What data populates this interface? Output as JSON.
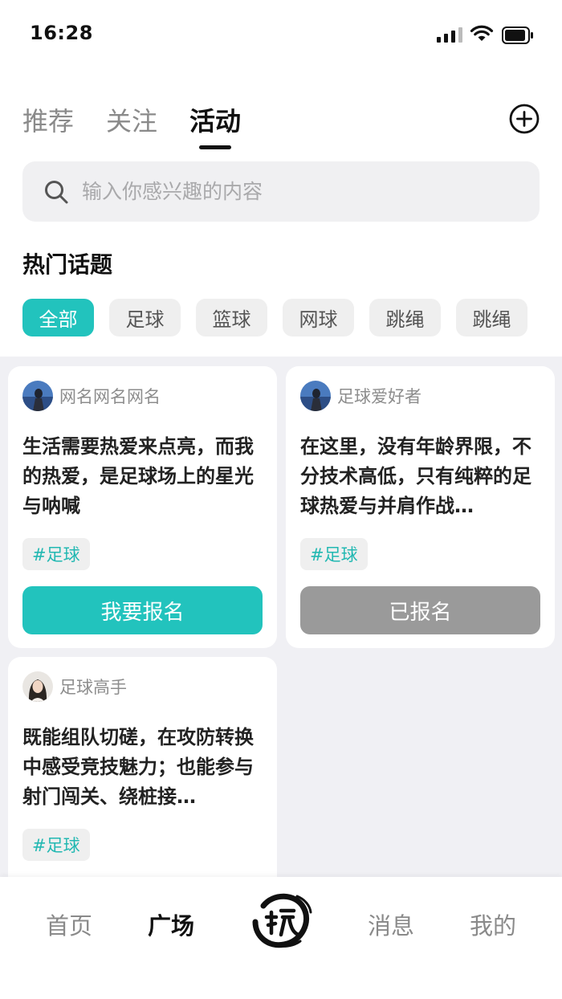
{
  "status_bar": {
    "time": "16:28"
  },
  "tabs": [
    {
      "label": "推荐",
      "active": false
    },
    {
      "label": "关注",
      "active": false
    },
    {
      "label": "活动",
      "active": true
    }
  ],
  "search": {
    "placeholder": "输入你感兴趣的内容",
    "value": ""
  },
  "hot_topics": {
    "title": "热门话题",
    "chips": [
      {
        "label": "全部",
        "active": true
      },
      {
        "label": "足球",
        "active": false
      },
      {
        "label": "篮球",
        "active": false
      },
      {
        "label": "网球",
        "active": false
      },
      {
        "label": "跳绳",
        "active": false
      },
      {
        "label": "跳绳",
        "active": false
      }
    ]
  },
  "cards": [
    {
      "user": "网名网名网名",
      "text": "生活需要热爱来点亮，而我的热爱，是足球场上的星光与呐喊",
      "tag": "#足球",
      "button": "我要报名",
      "registered": false
    },
    {
      "user": "足球爱好者",
      "text": "在这里，没有年龄界限，不分技术高低，只有纯粹的足球热爱与并肩作战…",
      "tag": "#足球",
      "button": "已报名",
      "registered": true
    },
    {
      "user": "足球高手",
      "text": "既能组队切磋，在攻防转换中感受竞技魅力；也能参与射门闯关、绕桩接…",
      "tag": "#足球"
    }
  ],
  "bottom_nav": [
    {
      "label": "首页",
      "active": false
    },
    {
      "label": "广场",
      "active": true
    },
    {
      "label": "消息",
      "active": false
    },
    {
      "label": "我的",
      "active": false
    }
  ],
  "colors": {
    "accent": "#22c3bd",
    "registered": "#9a9a9a",
    "feed_bg": "#f0f0f4"
  }
}
